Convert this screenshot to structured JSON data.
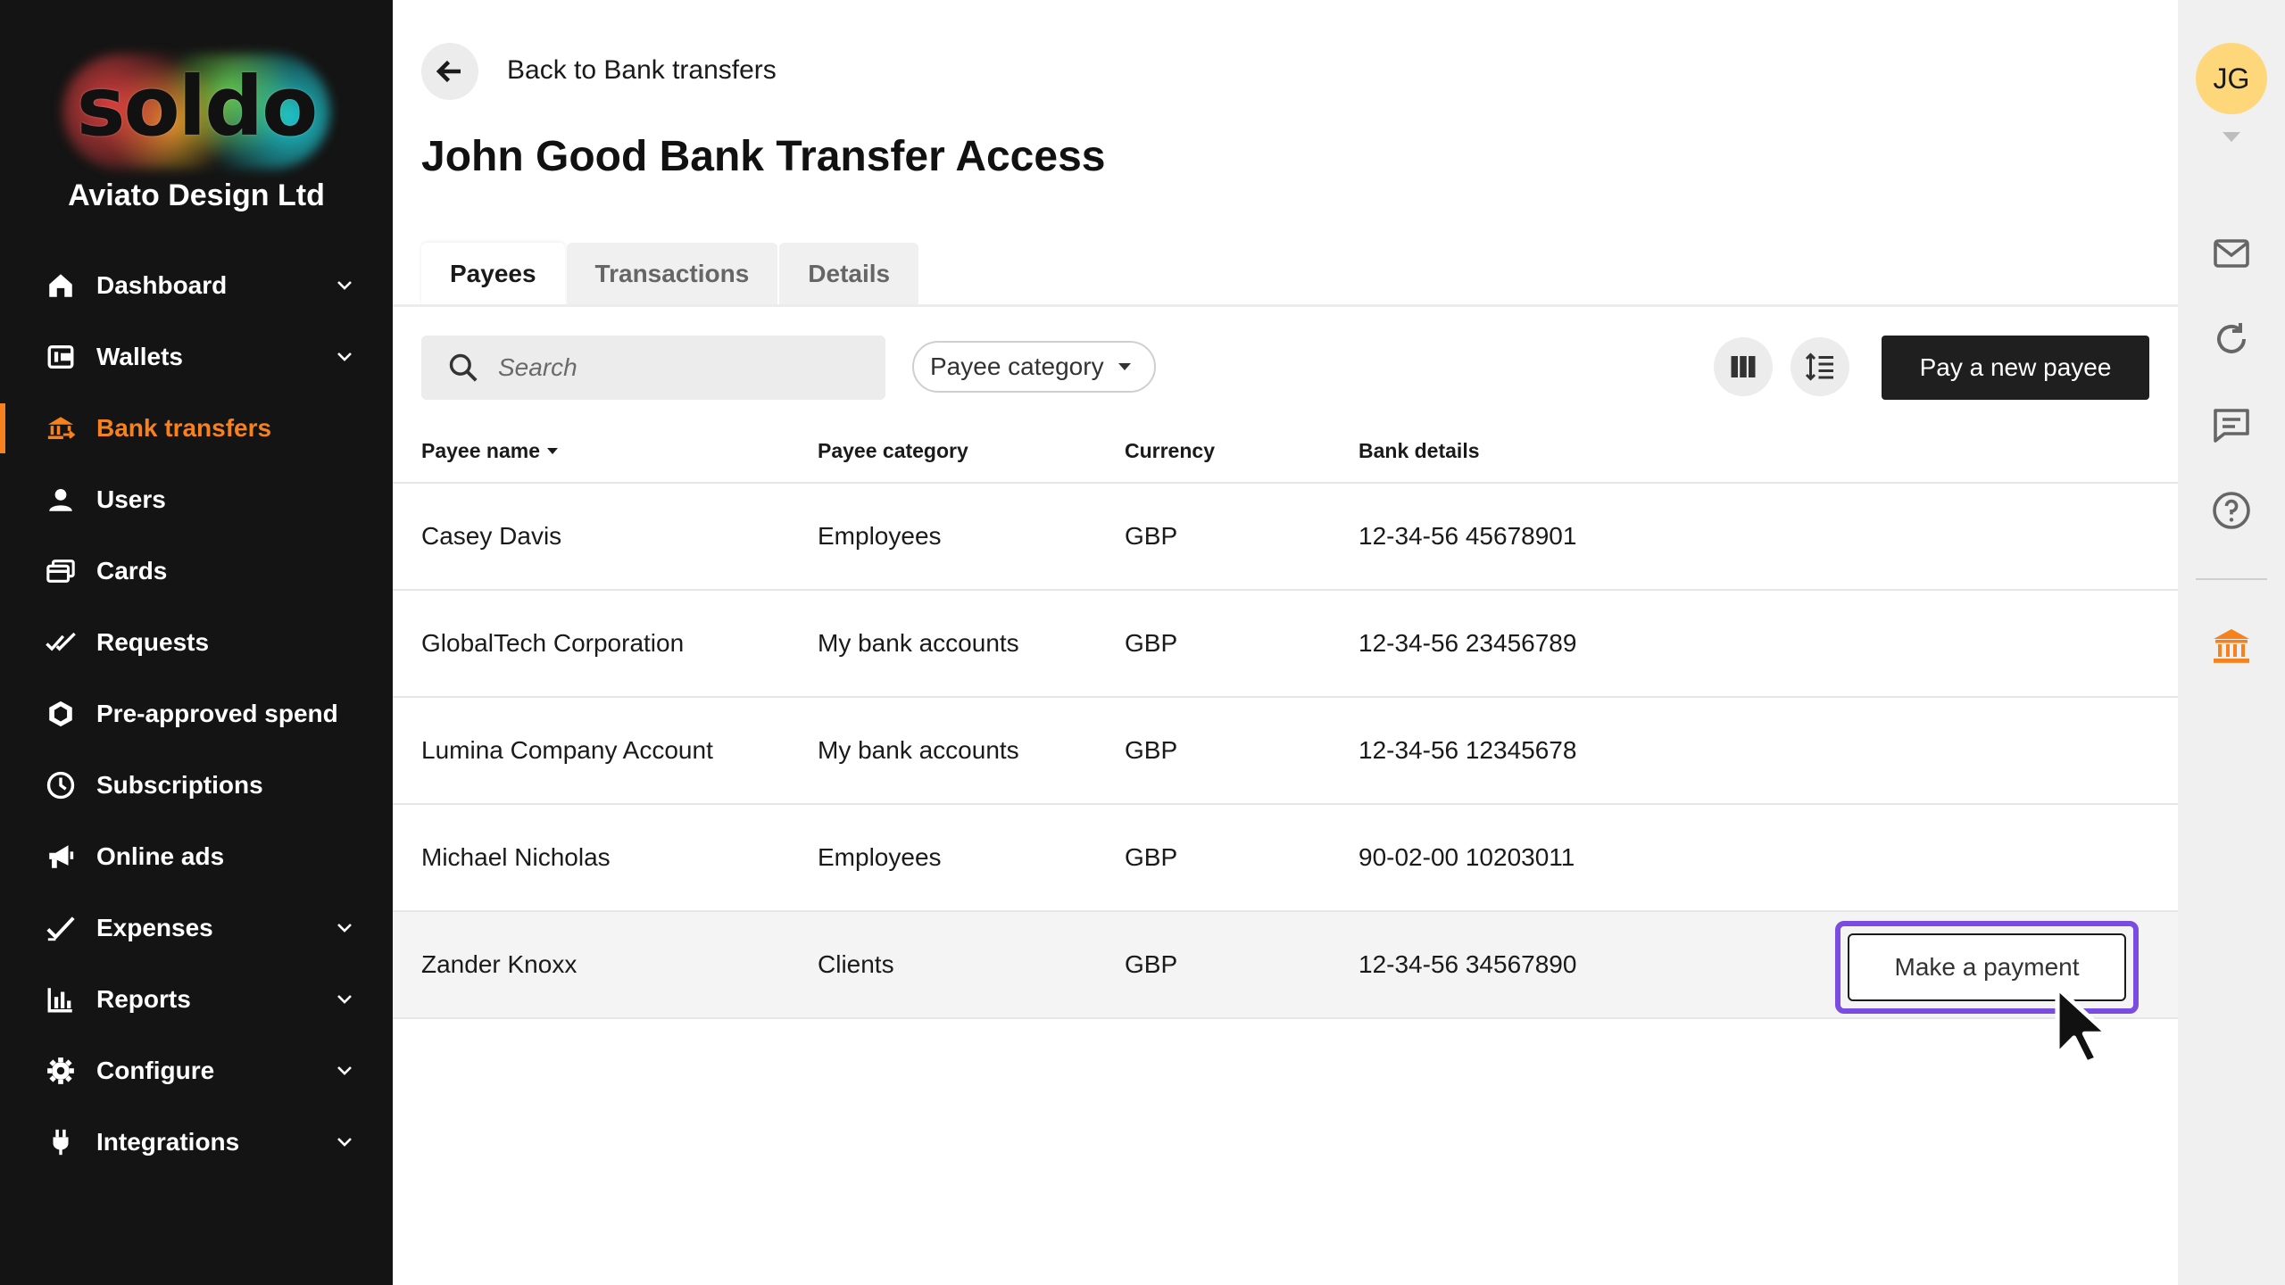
{
  "sidebar": {
    "logo_text": "soldo",
    "company": "Aviato Design Ltd",
    "items": [
      {
        "label": "Dashboard",
        "icon": "home-icon",
        "has_chevron": true
      },
      {
        "label": "Wallets",
        "icon": "wallet-icon",
        "has_chevron": true
      },
      {
        "label": "Bank transfers",
        "icon": "bank-transfer-icon",
        "active": true
      },
      {
        "label": "Users",
        "icon": "user-icon"
      },
      {
        "label": "Cards",
        "icon": "cards-icon"
      },
      {
        "label": "Requests",
        "icon": "double-check-icon"
      },
      {
        "label": "Pre-approved spend",
        "icon": "shield-icon"
      },
      {
        "label": "Subscriptions",
        "icon": "clock-icon"
      },
      {
        "label": "Online ads",
        "icon": "megaphone-icon"
      },
      {
        "label": "Expenses",
        "icon": "check-icon",
        "has_chevron": true
      },
      {
        "label": "Reports",
        "icon": "bar-chart-icon",
        "has_chevron": true
      },
      {
        "label": "Configure",
        "icon": "gear-icon",
        "has_chevron": true
      },
      {
        "label": "Integrations",
        "icon": "plug-icon",
        "has_chevron": true
      }
    ]
  },
  "header": {
    "back_label": "Back to Bank transfers",
    "title": "John Good Bank Transfer Access"
  },
  "tabs": [
    {
      "label": "Payees",
      "active": true
    },
    {
      "label": "Transactions"
    },
    {
      "label": "Details"
    }
  ],
  "toolbar": {
    "search_placeholder": "Search",
    "category_filter": "Payee category",
    "primary_button": "Pay a new payee"
  },
  "table": {
    "columns": [
      "Payee name",
      "Payee category",
      "Currency",
      "Bank details"
    ],
    "rows": [
      {
        "name": "Casey Davis",
        "category": "Employees",
        "currency": "GBP",
        "bank": "12-34-56 45678901"
      },
      {
        "name": "GlobalTech Corporation",
        "category": "My bank accounts",
        "currency": "GBP",
        "bank": "12-34-56 23456789"
      },
      {
        "name": "Lumina Company Account",
        "category": "My bank accounts",
        "currency": "GBP",
        "bank": "12-34-56 12345678"
      },
      {
        "name": "Michael Nicholas",
        "category": "Employees",
        "currency": "GBP",
        "bank": "90-02-00 10203011"
      },
      {
        "name": "Zander Knoxx",
        "category": "Clients",
        "currency": "GBP",
        "bank": "12-34-56 34567890",
        "action": "Make a payment"
      }
    ]
  },
  "rail": {
    "avatar_initials": "JG",
    "icons": [
      "mail-icon",
      "refresh-icon",
      "chat-icon",
      "help-icon",
      "bank-icon"
    ]
  },
  "colors": {
    "accent": "#f5821f",
    "sidebar_bg": "#141414",
    "focus": "#7a4de0",
    "avatar": "#fdd77a"
  }
}
